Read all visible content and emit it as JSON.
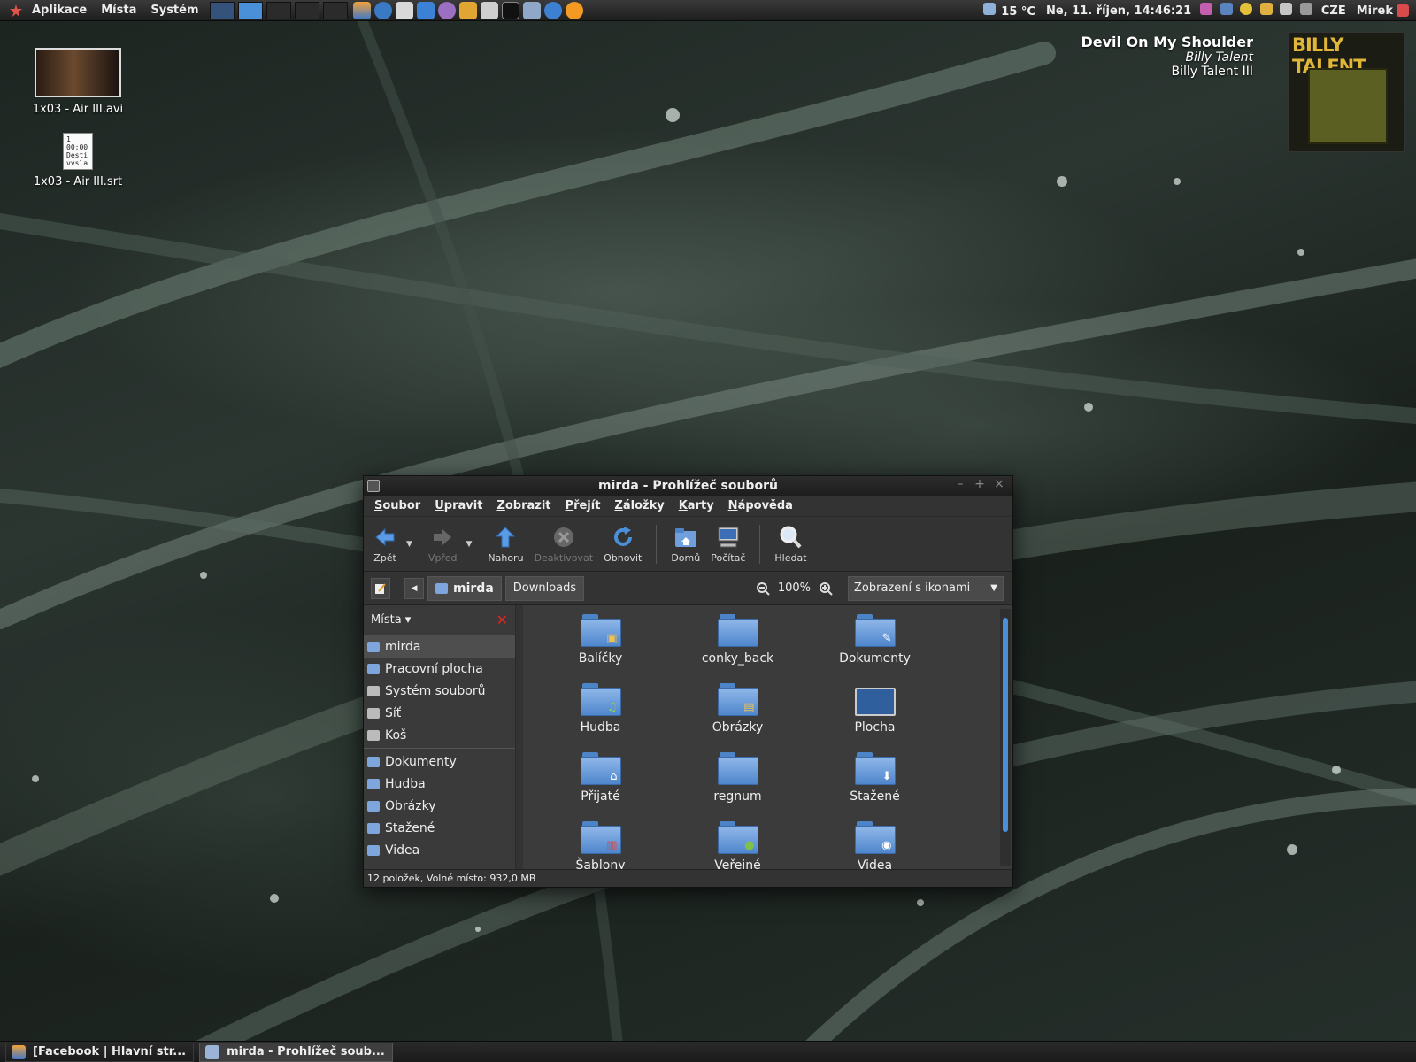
{
  "top_panel": {
    "menus": [
      "Aplikace",
      "Místa",
      "Systém"
    ],
    "weather": "15 °C",
    "clock": "Ne, 11. říjen, 14:46:21",
    "keyboard_layout": "CZE",
    "user": "Mirek"
  },
  "desktop": {
    "icons": [
      {
        "label": "1x03 - Air III.avi",
        "icon": "video-thumbnail"
      },
      {
        "label": "1x03 - Air III.srt",
        "icon": "subtitle-file",
        "preview": [
          "1",
          "00:00",
          "Desti",
          "vvsla"
        ]
      }
    ],
    "now_playing": {
      "title": "Devil On My Shoulder",
      "artist": "Billy Talent",
      "album": "Billy Talent III",
      "cover_text": "BILLY TALENT"
    }
  },
  "window": {
    "title": "mirda - Prohlížeč souborů",
    "menu": [
      "Soubor",
      "Upravit",
      "Zobrazit",
      "Přejít",
      "Záložky",
      "Karty",
      "Nápověda"
    ],
    "toolbar": {
      "back": "Zpět",
      "forward": "Vpřed",
      "up": "Nahoru",
      "stop": "Deaktivovat",
      "reload": "Obnovit",
      "home": "Domů",
      "computer": "Počítač",
      "search": "Hledat"
    },
    "location": {
      "current": "mirda",
      "next": "Downloads",
      "zoom": "100%",
      "view_mode": "Zobrazení s ikonami"
    },
    "sidebar": {
      "title": "Místa",
      "places": [
        {
          "label": "mirda",
          "icon": "home-icon"
        },
        {
          "label": "Pracovní plocha",
          "icon": "desktop-icon"
        },
        {
          "label": "Systém souborů",
          "icon": "drive-icon"
        },
        {
          "label": "Síť",
          "icon": "network-icon"
        },
        {
          "label": "Koš",
          "icon": "trash-icon"
        }
      ],
      "bookmarks": [
        "Dokumenty",
        "Hudba",
        "Obrázky",
        "Stažené",
        "Videa"
      ]
    },
    "files": [
      {
        "name": "Balíčky",
        "emblem": "package"
      },
      {
        "name": "conky_back",
        "emblem": ""
      },
      {
        "name": "Dokumenty",
        "emblem": "document"
      },
      {
        "name": "Hudba",
        "emblem": "music"
      },
      {
        "name": "Obrázky",
        "emblem": "pictures"
      },
      {
        "name": "Plocha",
        "emblem": "desktop"
      },
      {
        "name": "Přijaté",
        "emblem": "inbox"
      },
      {
        "name": "regnum",
        "emblem": ""
      },
      {
        "name": "Stažené",
        "emblem": "download"
      },
      {
        "name": "Šablony",
        "emblem": "templates"
      },
      {
        "name": "Veřejné",
        "emblem": "public"
      },
      {
        "name": "Videa",
        "emblem": "video"
      }
    ],
    "status": "12 položek, Volné místo: 932,0 MB"
  },
  "taskbar": {
    "tasks": [
      {
        "label": "[Facebook | Hlavní str...",
        "active": false
      },
      {
        "label": "mirda - Prohlížeč soub...",
        "active": true
      }
    ]
  },
  "colors": {
    "accent": "#4a90d9",
    "folder": "#6f9fdc",
    "close_red": "#e02424"
  }
}
